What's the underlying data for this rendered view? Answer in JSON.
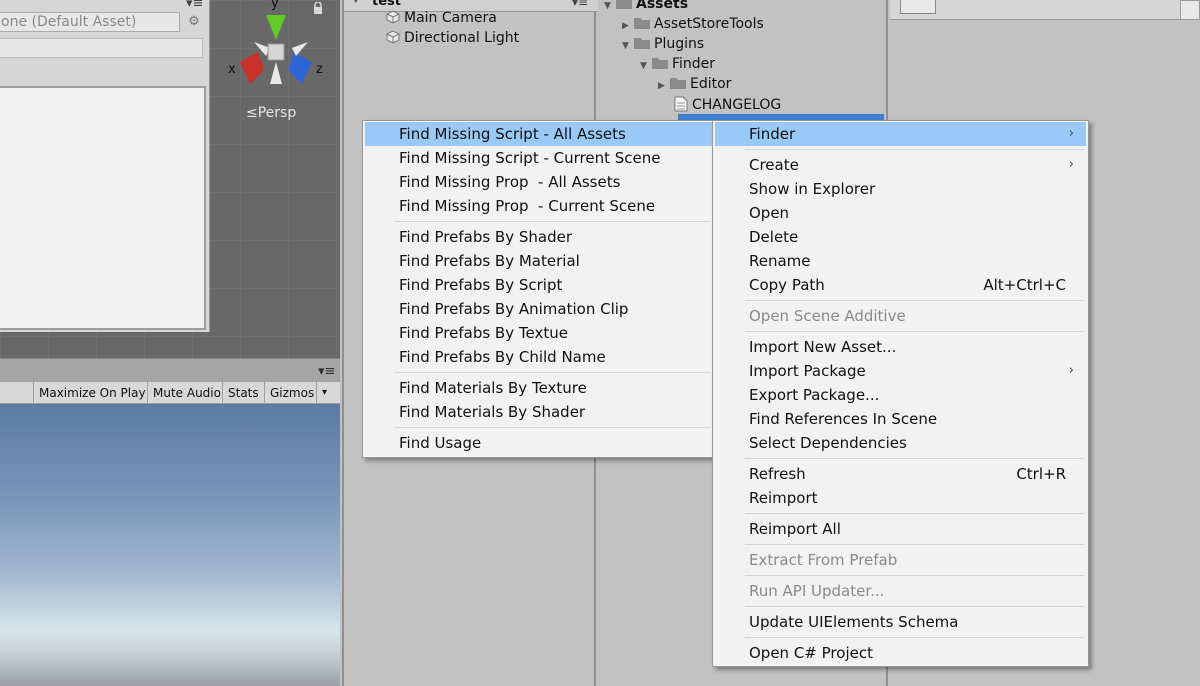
{
  "scene_view": {
    "shader_field": "one (Default Asset)",
    "persp_label": "≤Persp",
    "gizmo": {
      "y": "y",
      "x": "x",
      "z": "z"
    }
  },
  "game_view": {
    "toolbar": [
      "Maximize On Play",
      "Mute Audio",
      "Stats",
      "Gizmos"
    ],
    "gizmos_arrow": "▾"
  },
  "hierarchy": {
    "scene_title": "test",
    "items": [
      "Main Camera",
      "Directional Light"
    ]
  },
  "project": {
    "items": [
      {
        "label": "Assets",
        "bold": true
      },
      {
        "label": "AssetStoreTools"
      },
      {
        "label": "Plugins"
      },
      {
        "label": "Finder"
      },
      {
        "label": "Editor"
      },
      {
        "label": "CHANGELOG"
      }
    ]
  },
  "finder_submenu": {
    "groups": [
      [
        "Find Missing Script - All Assets",
        "Find Missing Script - Current Scene",
        "Find Missing Prop  - All Assets",
        "Find Missing Prop  - Current Scene"
      ],
      [
        "Find Prefabs By Shader",
        "Find Prefabs By Material",
        "Find Prefabs By Script",
        "Find Prefabs By Animation Clip",
        "Find Prefabs By Textue",
        "Find Prefabs By Child Name"
      ],
      [
        "Find Materials By Texture",
        "Find Materials By Shader"
      ],
      [
        "Find Usage"
      ]
    ],
    "highlighted": "Find Missing Script - All Assets"
  },
  "context_menu": {
    "finder": "Finder",
    "create": "Create",
    "show_in_explorer": "Show in Explorer",
    "open": "Open",
    "delete": "Delete",
    "rename": "Rename",
    "copy_path": "Copy Path",
    "copy_path_shortcut": "Alt+Ctrl+C",
    "open_scene_additive": "Open Scene Additive",
    "import_new_asset": "Import New Asset...",
    "import_package": "Import Package",
    "export_package": "Export Package...",
    "find_references": "Find References In Scene",
    "select_dependencies": "Select Dependencies",
    "refresh": "Refresh",
    "refresh_shortcut": "Ctrl+R",
    "reimport": "Reimport",
    "reimport_all": "Reimport All",
    "extract_from_prefab": "Extract From Prefab",
    "run_api_updater": "Run API Updater...",
    "update_uielements": "Update UIElements Schema",
    "open_csharp_project": "Open C# Project",
    "submenu_arrow": "›"
  },
  "colors": {
    "highlight": "#99c9f7",
    "selection": "#3e7fd4",
    "axis_x": "#c8322a",
    "axis_y": "#63c926",
    "axis_z": "#3065d6"
  }
}
